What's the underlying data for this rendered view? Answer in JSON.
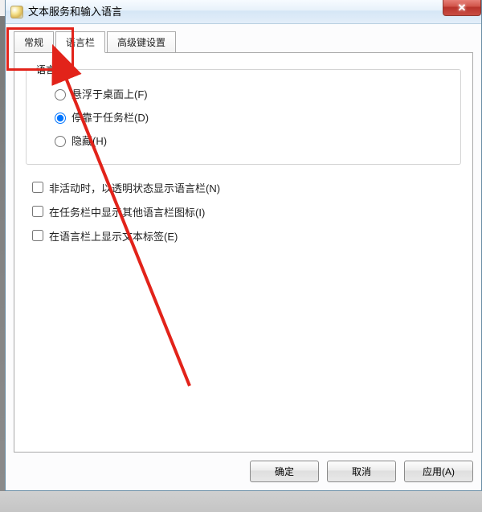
{
  "window": {
    "title": "文本服务和输入语言"
  },
  "tabs": {
    "general": "常规",
    "language_bar": "语言栏",
    "advanced": "高级键设置"
  },
  "group": {
    "legend": "语言栏"
  },
  "radios": {
    "float": "悬浮于桌面上(F)",
    "dock": "停靠于任务栏(D)",
    "hide": "隐藏(H)"
  },
  "checks": {
    "transparent": "非活动时，以透明状态显示语言栏(N)",
    "showicons": "在任务栏中显示其他语言栏图标(I)",
    "textlabels": "在语言栏上显示文本标签(E)"
  },
  "buttons": {
    "ok": "确定",
    "cancel": "取消",
    "apply": "应用(A)"
  }
}
